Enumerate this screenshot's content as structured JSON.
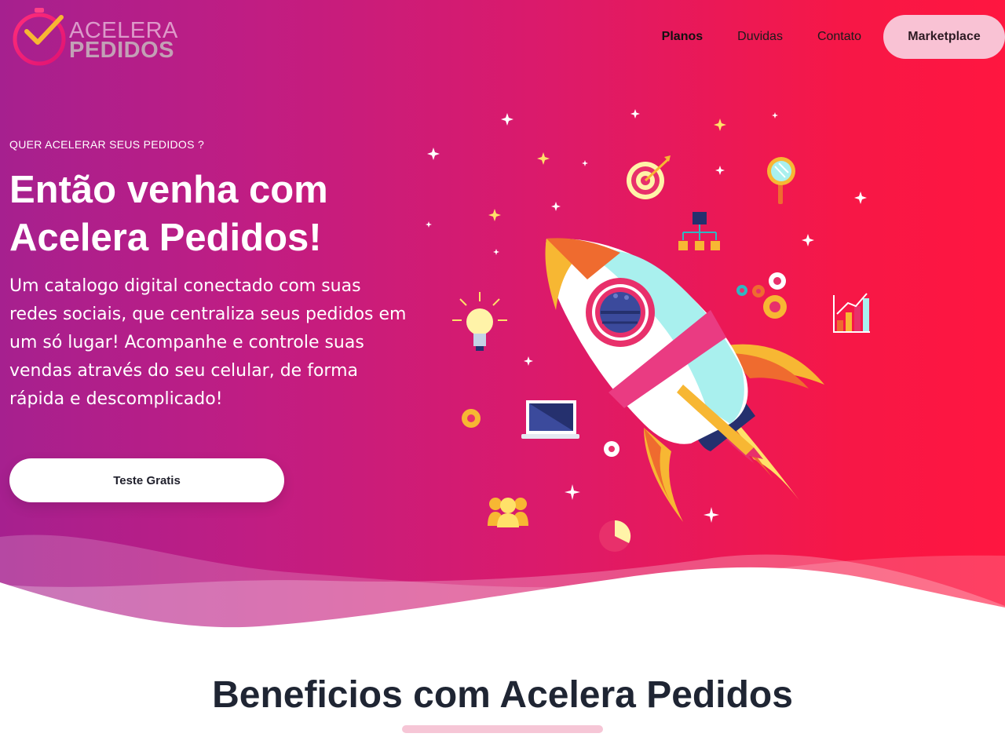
{
  "logo": {
    "line1": "ACELERA",
    "line2": "PEDIDOS"
  },
  "nav": {
    "items": [
      {
        "label": "Planos",
        "active": true
      },
      {
        "label": "Duvidas",
        "active": false
      },
      {
        "label": "Contato",
        "active": false
      }
    ],
    "button_label": "Marketplace"
  },
  "hero": {
    "eyebrow": "QUER ACELERAR SEUS PEDIDOS ?",
    "headline_line1": "Então venha com",
    "headline_line2": "Acelera Pedidos!",
    "description": "Um catalogo digital conectado com suas redes sociais, que centraliza seus pedidos em um só lugar! Acompanhe e controle suas vendas através do seu celular, de forma rápida e descomplicado!",
    "cta_label": "Teste Gratis"
  },
  "benefits": {
    "title": "Beneficios com Acelera Pedidos"
  },
  "colors": {
    "gradient_start": "#a6208f",
    "gradient_end": "#ff1640",
    "nav_button_bg": "#f9c2d4",
    "heading_dark": "#1f2533"
  },
  "icons": [
    "stopwatch-check-icon",
    "rocket-icon",
    "target-icon",
    "magnifier-icon",
    "org-chart-icon",
    "gears-icon",
    "bar-chart-icon",
    "lightbulb-icon",
    "laptop-icon",
    "users-icon",
    "pie-chart-icon",
    "sparkle-icon"
  ]
}
